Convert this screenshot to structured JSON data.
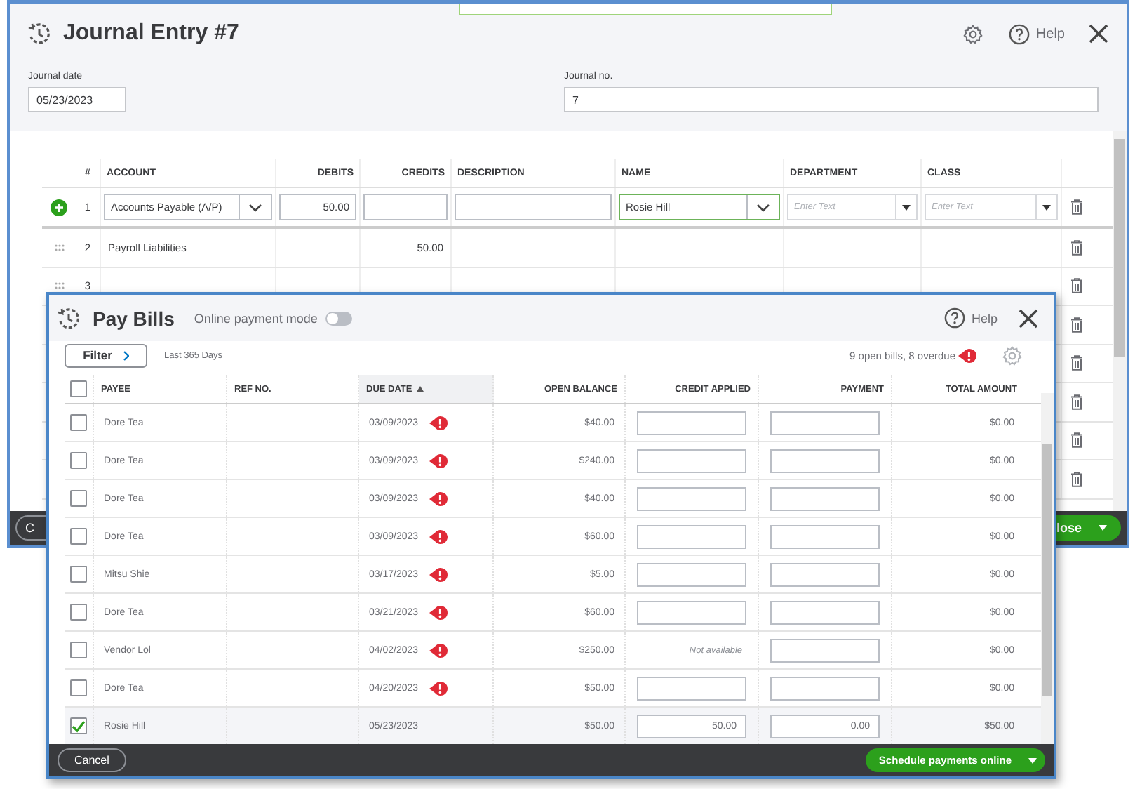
{
  "journal_entry": {
    "title": "Journal Entry #7",
    "help": "Help",
    "journal_date": {
      "label": "Journal date",
      "value": "05/23/2023"
    },
    "journal_no": {
      "label": "Journal no.",
      "value": "7"
    },
    "columns": [
      "#",
      "ACCOUNT",
      "DEBITS",
      "CREDITS",
      "DESCRIPTION",
      "NAME",
      "DEPARTMENT",
      "CLASS"
    ],
    "rows": [
      {
        "kind": "edit",
        "number": "1",
        "account": "Accounts Payable (A/P)",
        "debits": "50.00",
        "name": "Rosie Hill",
        "department_placeholder": "Enter Text",
        "class_placeholder": "Enter Text"
      },
      {
        "kind": "view",
        "number": "2",
        "account": "Payroll Liabilities",
        "credits": "50.00"
      },
      {
        "kind": "view",
        "number": "3"
      },
      {
        "kind": "blank"
      },
      {
        "kind": "blank"
      },
      {
        "kind": "blank"
      },
      {
        "kind": "blank"
      },
      {
        "kind": "blank"
      }
    ],
    "footer": {
      "cancel": "C",
      "save": "lose"
    }
  },
  "pay_bills": {
    "title": "Pay Bills",
    "online_payment_mode": {
      "label": "Online payment mode",
      "on": false
    },
    "help": "Help",
    "filter": "Filter",
    "filter_range": "Last 365 Days",
    "summary": "9 open bills, 8 overdue",
    "all_selected": false,
    "columns": [
      {
        "label": "PAYEE",
        "sorted": false
      },
      {
        "label": "REF NO.",
        "sorted": false
      },
      {
        "label": "DUE DATE",
        "sorted": true
      },
      {
        "label": "OPEN BALANCE",
        "sorted": false
      },
      {
        "label": "CREDIT APPLIED",
        "sorted": false
      },
      {
        "label": "PAYMENT",
        "sorted": false
      },
      {
        "label": "TOTAL AMOUNT",
        "sorted": false
      }
    ],
    "rows": [
      {
        "selected": false,
        "payee": "Dore Tea",
        "due_date": "03/09/2023",
        "overdue": true,
        "open_balance": "$40.00",
        "credit": {
          "kind": "field"
        },
        "total": "$0.00"
      },
      {
        "selected": false,
        "payee": "Dore Tea",
        "due_date": "03/09/2023",
        "overdue": true,
        "open_balance": "$240.00",
        "credit": {
          "kind": "field"
        },
        "total": "$0.00"
      },
      {
        "selected": false,
        "payee": "Dore Tea",
        "due_date": "03/09/2023",
        "overdue": true,
        "open_balance": "$40.00",
        "credit": {
          "kind": "field"
        },
        "total": "$0.00"
      },
      {
        "selected": false,
        "payee": "Dore Tea",
        "due_date": "03/09/2023",
        "overdue": true,
        "open_balance": "$60.00",
        "credit": {
          "kind": "field"
        },
        "total": "$0.00"
      },
      {
        "selected": false,
        "payee": "Mitsu Shie",
        "due_date": "03/17/2023",
        "overdue": true,
        "open_balance": "$5.00",
        "credit": {
          "kind": "field"
        },
        "total": "$0.00"
      },
      {
        "selected": false,
        "payee": "Dore Tea",
        "due_date": "03/21/2023",
        "overdue": true,
        "open_balance": "$60.00",
        "credit": {
          "kind": "field"
        },
        "total": "$0.00"
      },
      {
        "selected": false,
        "payee": "Vendor Lol",
        "due_date": "04/02/2023",
        "overdue": true,
        "open_balance": "$250.00",
        "credit": {
          "kind": "text",
          "text": "Not available"
        },
        "total": "$0.00"
      },
      {
        "selected": false,
        "payee": "Dore Tea",
        "due_date": "04/20/2023",
        "overdue": true,
        "open_balance": "$50.00",
        "credit": {
          "kind": "field"
        },
        "total": "$0.00"
      },
      {
        "selected": true,
        "payee": "Rosie Hill",
        "due_date": "05/23/2023",
        "overdue": false,
        "open_balance": "$50.00",
        "credit": {
          "kind": "field",
          "value": "50.00"
        },
        "payment": "0.00",
        "total": "$50.00"
      }
    ],
    "footer": {
      "cancel": "Cancel",
      "primary": "Schedule payments online"
    }
  }
}
